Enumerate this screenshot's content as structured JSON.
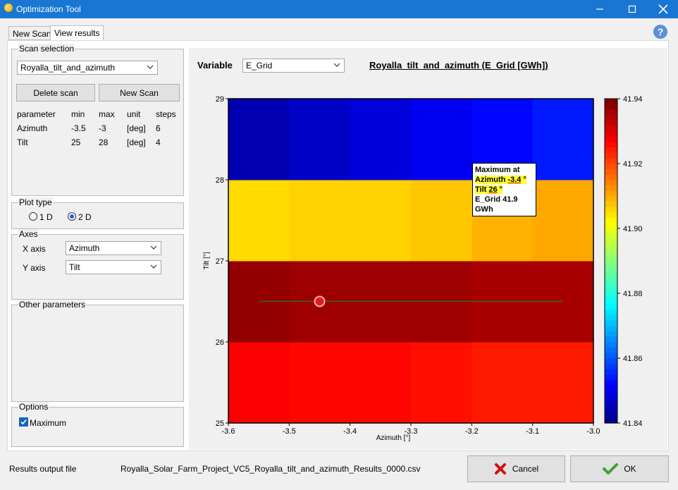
{
  "window": {
    "title": "Optimization Tool",
    "minimize": "—",
    "maximize": "☐",
    "close": "✕"
  },
  "tabs": [
    {
      "label": "New Scan"
    },
    {
      "label": "View results"
    }
  ],
  "help": "?",
  "scan_selection": {
    "legend": "Scan selection",
    "selected": "Royalla_tilt_and_azimuth",
    "delete_label": "Delete scan",
    "new_label": "New Scan",
    "headers": [
      "parameter",
      "min",
      "max",
      "unit",
      "steps"
    ],
    "rows": [
      [
        "Azimuth",
        "-3.5",
        "-3",
        "[deg]",
        "6"
      ],
      [
        "Tilt",
        "25",
        "28",
        "[deg]",
        "4"
      ]
    ]
  },
  "plot_type": {
    "legend": "Plot type",
    "opt_1d": "1 D",
    "opt_2d": "2 D",
    "selected": "2 D"
  },
  "axes": {
    "legend": "Axes",
    "x_label": "X axis",
    "x_value": "Azimuth",
    "y_label": "Y axis",
    "y_value": "Tilt"
  },
  "other_parameters": {
    "legend": "Other parameters"
  },
  "options": {
    "legend": "Options",
    "maximum_label": "Maximum",
    "maximum_checked": true
  },
  "plot_header": {
    "variable_label": "Variable",
    "variable_value": "E_Grid",
    "title": "Royalla_tilt_and_azimuth (E_Grid [GWh])"
  },
  "tooltip": {
    "line1": "Maximum at",
    "az_label": "Azimuth ",
    "az_value": "-3.4",
    "az_unit": " °",
    "tilt_label": "Tilt ",
    "tilt_value": "26",
    "tilt_unit": " °",
    "grid_label": "E_Grid ",
    "grid_value": "41.9 GWh"
  },
  "footer": {
    "output_label": "Results output file",
    "output_file": "Royalla_Solar_Farm_Project_VC5_Royalla_tilt_and_azimuth_Results_0000.csv",
    "cancel_label": "Cancel",
    "ok_label": "OK"
  },
  "chart_data": {
    "type": "heatmap",
    "title": "Royalla_tilt_and_azimuth (E_Grid [GWh])",
    "xlabel": "Azimuth [°]",
    "ylabel": "Tilt [°]",
    "xlim": [
      -3.6,
      -3.0
    ],
    "ylim": [
      25,
      29
    ],
    "x_ticks": [
      -3.6,
      -3.5,
      -3.4,
      -3.3,
      -3.2,
      -3.1,
      -3.0
    ],
    "y_ticks": [
      25,
      26,
      27,
      28,
      29
    ],
    "x_cells": [
      -3.5,
      -3.4,
      -3.3,
      -3.2,
      -3.1,
      -3.0
    ],
    "y_cells": [
      25,
      26,
      27,
      28
    ],
    "z": [
      [
        41.928,
        41.927,
        41.927,
        41.926,
        41.925,
        41.925
      ],
      [
        41.938,
        41.937,
        41.937,
        41.937,
        41.936,
        41.936
      ],
      [
        41.906,
        41.907,
        41.907,
        41.908,
        41.91,
        41.911
      ],
      [
        41.845,
        41.847,
        41.849,
        41.851,
        41.853,
        41.855
      ]
    ],
    "colorbar": {
      "min": 41.84,
      "max": 41.94,
      "ticks": [
        41.84,
        41.86,
        41.88,
        41.9,
        41.92,
        41.94
      ]
    },
    "max_point": {
      "x": -3.45,
      "y": 26.5
    },
    "trace_line": {
      "x": [
        -3.55,
        -3.05
      ],
      "y": [
        26.5,
        26.5
      ]
    },
    "grid": false
  }
}
